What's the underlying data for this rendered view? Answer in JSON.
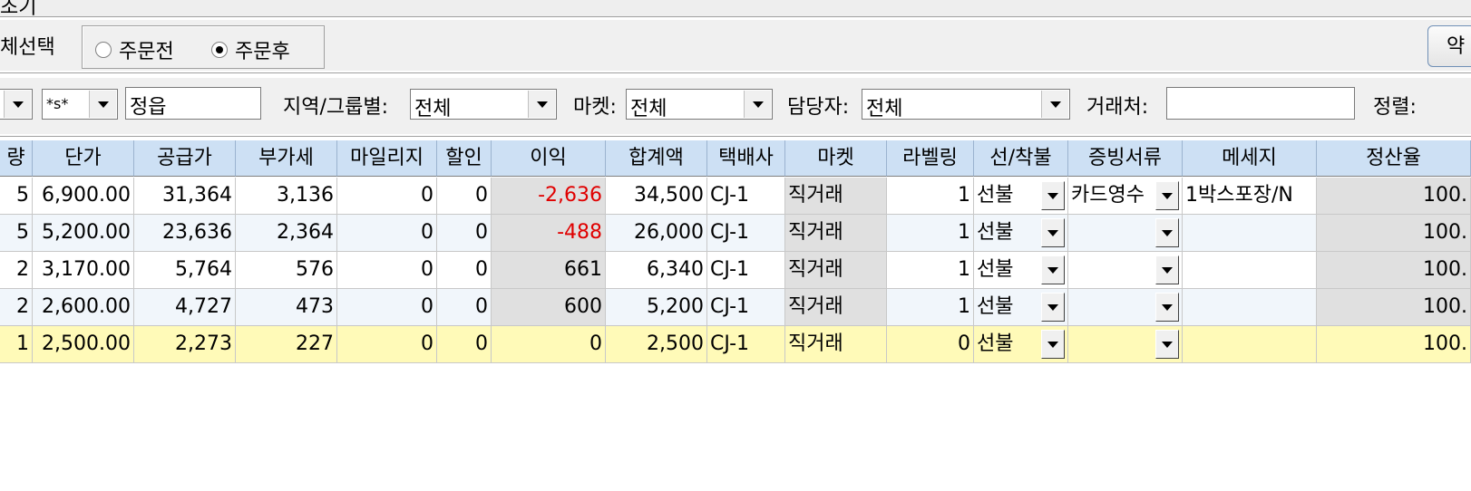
{
  "window_title": "조기",
  "filter": {
    "label_partial": "체선택",
    "radio_before": "주문전",
    "radio_after": "주문후",
    "right_button": "약"
  },
  "search": {
    "combo1_value": "",
    "combo2_value": "*s*",
    "name_value": "정읍",
    "region_label": "지역/그룹별:",
    "region_value": "전체",
    "market_label": "마켓:",
    "market_value": "전체",
    "manager_label": "담당자:",
    "manager_value": "전체",
    "client_label": "거래처:",
    "client_value": "",
    "sort_label": "정렬:"
  },
  "grid": {
    "headers": [
      "량",
      "단가",
      "공급가",
      "부가세",
      "마일리지",
      "할인",
      "이익",
      "합계액",
      "택배사",
      "마켓",
      "라벨링",
      "선/착불",
      "증빙서류",
      "메세지",
      "정산율"
    ],
    "rows": [
      {
        "qty": "5",
        "price": "6,900.00",
        "supply": "31,364",
        "vat": "3,136",
        "mileage": "0",
        "discount": "0",
        "profit": "-2,636",
        "total": "34,500",
        "courier": "CJ-1",
        "market": "직거래",
        "label": "1",
        "pay": "선불",
        "doc": "카드영수",
        "msg": "1박스포장/N",
        "rate": "100."
      },
      {
        "qty": "5",
        "price": "5,200.00",
        "supply": "23,636",
        "vat": "2,364",
        "mileage": "0",
        "discount": "0",
        "profit": "-488",
        "total": "26,000",
        "courier": "CJ-1",
        "market": "직거래",
        "label": "1",
        "pay": "선불",
        "doc": "",
        "msg": "",
        "rate": "100."
      },
      {
        "qty": "2",
        "price": "3,170.00",
        "supply": "5,764",
        "vat": "576",
        "mileage": "0",
        "discount": "0",
        "profit": "661",
        "total": "6,340",
        "courier": "CJ-1",
        "market": "직거래",
        "label": "1",
        "pay": "선불",
        "doc": "",
        "msg": "",
        "rate": "100."
      },
      {
        "qty": "2",
        "price": "2,600.00",
        "supply": "4,727",
        "vat": "473",
        "mileage": "0",
        "discount": "0",
        "profit": "600",
        "total": "5,200",
        "courier": "CJ-1",
        "market": "직거래",
        "label": "1",
        "pay": "선불",
        "doc": "",
        "msg": "",
        "rate": "100."
      },
      {
        "qty": "1",
        "price": "2,500.00",
        "supply": "2,273",
        "vat": "227",
        "mileage": "0",
        "discount": "0",
        "profit": "0",
        "total": "2,500",
        "courier": "CJ-1",
        "market": "직거래",
        "label": "0",
        "pay": "선불",
        "doc": "",
        "msg": "",
        "rate": "100."
      }
    ],
    "selected_row": 4
  },
  "colors": {
    "header_bg": "#cde0f4",
    "selected_row_bg": "#fffab8",
    "negative_text": "#e00000",
    "alt_row_bg": "#f1f6fb"
  }
}
